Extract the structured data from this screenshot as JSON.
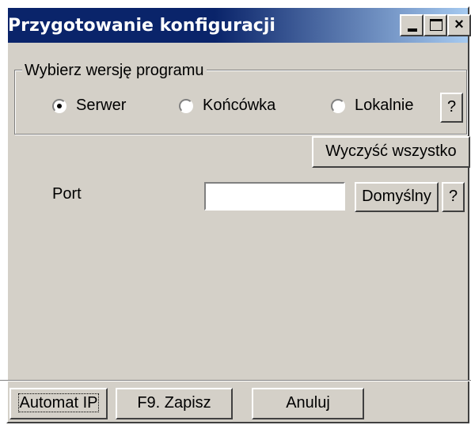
{
  "window": {
    "title": "Przygotowanie konfiguracji",
    "controls": {
      "minimize": "_",
      "maximize": "□",
      "close": "×"
    }
  },
  "version_group": {
    "legend": "Wybierz wersję programu",
    "options": [
      {
        "label": "Serwer",
        "selected": true
      },
      {
        "label": "Końcówka",
        "selected": false
      },
      {
        "label": "Lokalnie",
        "selected": false
      }
    ],
    "help_label": "?"
  },
  "clear_all_label": "Wyczyść wszystko",
  "port": {
    "label": "Port",
    "value": "",
    "default_label": "Domyślny",
    "help_label": "?"
  },
  "footer": {
    "auto_ip_label": "Automat IP",
    "save_label": "F9. Zapisz",
    "cancel_label": "Anuluj"
  }
}
